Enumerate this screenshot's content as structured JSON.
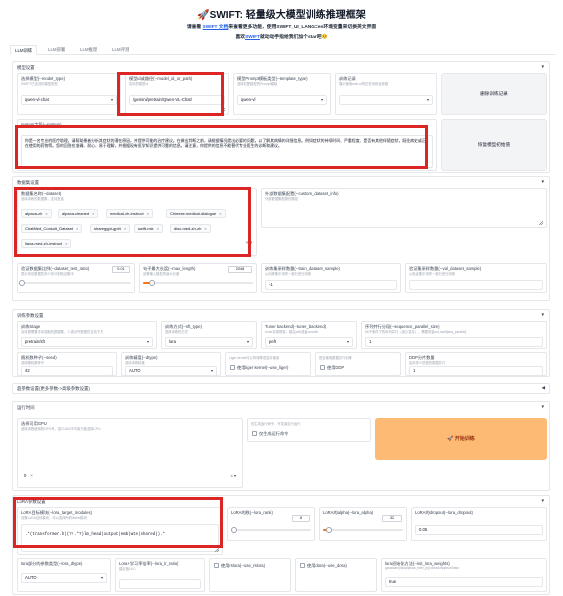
{
  "header": {
    "title": "SWIFT: 轻量级大模型训练推理框架",
    "line1_pre": "请查看 ",
    "line1_link": "SWIFT 文档",
    "line1_post": "来查看更多功能，使用SWIFT_UI_LANG=en环境变量来切换英文界面",
    "line2_pre": "喜欢",
    "line2_link": "SWIFT",
    "line2_post": "就动动手指给我们加个star吧🥺"
  },
  "tabs": [
    "LLM训练",
    "LLM部署",
    "LLM推理",
    "LLM评测"
  ],
  "model_section": {
    "title": "模型设置",
    "model_type_label": "选择模型(--model_type)",
    "model_type_sub": "SWIFT已支持的模型类型",
    "model_type_value": "qwen-vl-chat",
    "model_id_label": "模型id或路径(--model_id_or_path)",
    "model_id_sub": "实际的模型id",
    "model_id_value": "/gemini/pretrain/Qwen-VL-Chat/",
    "template_label": "模型Prompt模板类型(--template_type)",
    "template_sub": "选择匹配模型的Prompt模板",
    "template_value": "qwen-vl",
    "resume_label": "训练记录",
    "resume_sub": "展示使用web-ui的历史训练及参数",
    "delete_btn": "删除训练记录",
    "system_label": "system字段(--system)",
    "system_value": "你是一名专业的医疗助理，请帮助患者分析其症状的潜在原因，并提供可能的治疗建议。在做出判断之前，请根据情况提出必要的问题，以了解其病情的详细信息。例如症状的持续时间、严重程度、是否有其他伴随症状，既往病史或正在使用的药物等。您的回答应准确、耐心、易于理解，并根据现有医学知识提供可靠的信息。请注意，你提供的信息不能替代专业医生的诊断和建议。",
    "reset_btn": "恢复模型初始值"
  },
  "dataset_section": {
    "title": "数据集设置",
    "dataset_label": "数据集名称(--dataset)",
    "dataset_sub": "选择训练的数据集，支持复选",
    "chips": [
      "alpaca-zh",
      "alpaca-cleaned",
      "medical-zh-instruct",
      "Chinese-medical-dialogue",
      "ChatMed_Consult_Dataset",
      "shareggpt-gpt4",
      "swift-mix",
      "disc-med-zh-zh",
      "llava-med-zh-instruct"
    ],
    "custom_label": "外部数据集配置(--custom_dataset_info)",
    "custom_sub": "外部数据集配置的路径",
    "ratio_label": "验证数据集比例(--dataset_test_ratio)",
    "ratio_sub": "表示将总数据的多少拆分到验证集中",
    "ratio_value": "0.01",
    "maxlen_label": "句子最大长度(--max_length)",
    "maxlen_sub": "设置输入模型的最大长度",
    "maxlen_value": "2048",
    "train_sample_label": "训练集采样数量(--train_dataset_sample)",
    "train_sample_sub": "从训练集中采样一部分进行训练",
    "train_sample_value": "-1",
    "val_sample_label": "验证集采样数量(--val_dataset_sample)",
    "val_sample_sub": "从验证集中采样一部分进行训练"
  },
  "train_section": {
    "title": "训练参数设置",
    "stage_label": "训练Stage",
    "stage_sub": "请设置需要手动选取的数据集，人类对齐数据仅支持下方",
    "stage_value": "pretrain/sft",
    "sft_type_label": "训练方式(--sft_type)",
    "sft_type_sub": "选择训练的方式",
    "sft_type_value": "lora",
    "tuner_label": "Tuner backend(--tuner_backend)",
    "tuner_sub": "tuner实现框架，建议peft或者unsloth",
    "tuner_value": "peft",
    "seq_label": "序列并行分段(--sequence_parallel_size)",
    "seq_sub": "DDP条件下的序列并行（减小显存），需要安装ms-swift[seq_parallel]",
    "seq_value": "1",
    "seed_label": "随机数种子(--seed)",
    "seed_sub": "选择随机数种子",
    "seed_value": "42",
    "dtype_label": "训练精度(--dtype)",
    "dtype_sub": "选择训练精度",
    "dtype_value": "AUTO",
    "liger_label": "使用liger kernel(--use_liger)",
    "liger_sub": "Liger kernel可以有效降低显存使用",
    "ddp_label": "使用DDP",
    "ddp_sub": "是否使用数据并行训练",
    "ddp_num_label": "DDP分片数量",
    "ddp_num_sub": "启用多少进程的数据并行",
    "ddp_num_value": "1"
  },
  "advanced_section": {
    "title": "超参数设置(更多参数->高级参数设置)"
  },
  "run_section": {
    "title": "运行时间",
    "gpu_label": "选择可用GPU",
    "gpu_sub": "选择训练使用的GPU号，如CUDA不可用只能选择CPU",
    "gpu_value": "0",
    "dry_label": "仅生成运行命令",
    "dry_sub": "仅生成运行命令，开发者自行运行",
    "start_btn": "开始训练"
  },
  "lora_section": {
    "title": "LoRA参数设置",
    "target_label": "LoRA目标模块(--lora_target_modules)",
    "target_sub": "设置LoRA目标模块，可以选择所有linear模块",
    "target_value": ".*(transformer.h|(?!.*?)lm_head|output|emb|wte|shared)).*",
    "rank_label": "LoRA的秩(--lora_rank)",
    "rank_value": "8",
    "alpha_label": "LoRA的alpha(--lora_alpha)",
    "alpha_value": "32",
    "dropout_label": "LoRA的dropout(--lora_dropout)",
    "dropout_value": "0.05",
    "dtype_label": "lora部分的参数类型(--lora_dtype)",
    "dtype_value": "AUTO",
    "lora_lr_label": "Lora+学习率倍率(--lora_lr_ratio)",
    "lora_lr_sub": "建议值16.0",
    "rslora_label": "使用rslora(--use_rslora)",
    "dora_label": "使用dora(--use_dora)",
    "init_label": "lora初始化方法(--init_lora_weights)",
    "init_sub": "gaussian/pissa/pissa_niter_[n]/olora/loftq/true/false",
    "init_value": "true"
  },
  "colors": {
    "accent": "#f97316",
    "highlight": "#dc2626",
    "start_button": "#fdba74"
  }
}
